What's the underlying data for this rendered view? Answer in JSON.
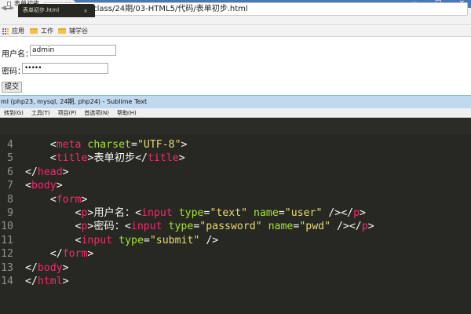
{
  "browser": {
    "tab_title": "表单初步",
    "tab_close": "×",
    "window_controls": [
      "−",
      "□",
      "×"
    ],
    "nav": {
      "back": "←",
      "forward": "→",
      "reload": "C"
    },
    "info_icon": "i",
    "url": "file:///D:/class/24期/03-HTML5/代码/表单初步.html",
    "bookmarks": [
      {
        "label": "应用",
        "icon": "apps-grid-icon"
      },
      {
        "label": "工作",
        "icon": "folder-icon"
      },
      {
        "label": "辅学谷",
        "icon": "folder-icon"
      }
    ]
  },
  "page": {
    "username_label": "用户名：",
    "username_value": "admin",
    "password_label": "密码：",
    "password_value": "•••••",
    "submit_label": "提交"
  },
  "sublime": {
    "title": "ml (php23, mysql, 24期, php24) - Sublime Text",
    "menu": [
      "转到(G)",
      "工具(T)",
      "项目(P)",
      "首选项(N)",
      "帮助(H)"
    ],
    "tab_arrows": "◀ ▶",
    "tab_label": "表单初步.html",
    "tab_close": "×",
    "line_numbers": [
      "4",
      "5",
      "6",
      "7",
      "8",
      "9",
      "10",
      "11",
      "12",
      "13",
      "14"
    ],
    "lines": [
      [
        {
          "c": "p",
          "t": "    <"
        },
        {
          "c": "t",
          "t": "meta"
        },
        {
          "c": "p",
          "t": " "
        },
        {
          "c": "a",
          "t": "charset"
        },
        {
          "c": "p",
          "t": "="
        },
        {
          "c": "s",
          "t": "\"UTF-8\""
        },
        {
          "c": "p",
          "t": ">"
        }
      ],
      [
        {
          "c": "p",
          "t": "    <"
        },
        {
          "c": "t",
          "t": "title"
        },
        {
          "c": "p",
          "t": ">表单初步</"
        },
        {
          "c": "t",
          "t": "title"
        },
        {
          "c": "p",
          "t": ">"
        }
      ],
      [
        {
          "c": "p",
          "t": "</"
        },
        {
          "c": "t",
          "t": "head"
        },
        {
          "c": "p",
          "t": ">"
        }
      ],
      [
        {
          "c": "p",
          "t": "<"
        },
        {
          "c": "t",
          "t": "body"
        },
        {
          "c": "p",
          "t": ">"
        }
      ],
      [
        {
          "c": "p",
          "t": "    <"
        },
        {
          "c": "t",
          "t": "form"
        },
        {
          "c": "p",
          "t": ">"
        }
      ],
      [
        {
          "c": "p",
          "t": "        <"
        },
        {
          "c": "t",
          "t": "p"
        },
        {
          "c": "p",
          "t": ">用户名：<"
        },
        {
          "c": "t",
          "t": "input"
        },
        {
          "c": "p",
          "t": " "
        },
        {
          "c": "a",
          "t": "type"
        },
        {
          "c": "p",
          "t": "="
        },
        {
          "c": "s",
          "t": "\"text\""
        },
        {
          "c": "p",
          "t": " "
        },
        {
          "c": "a",
          "t": "name"
        },
        {
          "c": "p",
          "t": "="
        },
        {
          "c": "s",
          "t": "\"user\""
        },
        {
          "c": "p",
          "t": " /></"
        },
        {
          "c": "t",
          "t": "p"
        },
        {
          "c": "p",
          "t": ">"
        }
      ],
      [
        {
          "c": "p",
          "t": "        <"
        },
        {
          "c": "t",
          "t": "p"
        },
        {
          "c": "p",
          "t": ">密码：<"
        },
        {
          "c": "t",
          "t": "input"
        },
        {
          "c": "p",
          "t": " "
        },
        {
          "c": "a",
          "t": "type"
        },
        {
          "c": "p",
          "t": "="
        },
        {
          "c": "s",
          "t": "\"password\""
        },
        {
          "c": "p",
          "t": " "
        },
        {
          "c": "a",
          "t": "name"
        },
        {
          "c": "p",
          "t": "="
        },
        {
          "c": "s",
          "t": "\"pwd\""
        },
        {
          "c": "p",
          "t": " /></"
        },
        {
          "c": "t",
          "t": "p"
        },
        {
          "c": "p",
          "t": ">"
        }
      ],
      [
        {
          "c": "p",
          "t": "        <"
        },
        {
          "c": "t",
          "t": "input"
        },
        {
          "c": "p",
          "t": " "
        },
        {
          "c": "a",
          "t": "type"
        },
        {
          "c": "p",
          "t": "="
        },
        {
          "c": "s",
          "t": "\"submit\""
        },
        {
          "c": "p",
          "t": " />"
        }
      ],
      [
        {
          "c": "p",
          "t": "    </"
        },
        {
          "c": "t",
          "t": "form"
        },
        {
          "c": "p",
          "t": ">"
        }
      ],
      [
        {
          "c": "p",
          "t": "</"
        },
        {
          "c": "t",
          "t": "body"
        },
        {
          "c": "p",
          "t": ">"
        }
      ],
      [
        {
          "c": "p",
          "t": "</"
        },
        {
          "c": "t",
          "t": "html"
        },
        {
          "c": "p",
          "t": ">"
        }
      ]
    ]
  },
  "colors": {
    "tag": "#f92672",
    "attribute": "#a6e22e",
    "string": "#e6db74",
    "text": "#f8f8f2",
    "editor_bg": "#272822",
    "browser_tabbar": "#4778b8"
  }
}
